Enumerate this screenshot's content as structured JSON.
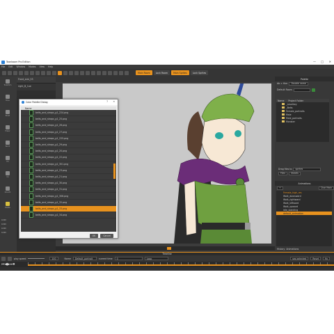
{
  "app": {
    "title": "Toonboom Pro Edition",
    "window_controls": [
      "—",
      "□",
      "✕"
    ]
  },
  "menu": [
    "File",
    "Edit",
    "Window",
    "Modes",
    "View",
    "Help"
  ],
  "rooms": [
    {
      "label": "Main Room",
      "active": true
    },
    {
      "label": "Lock Room",
      "active": false
    },
    {
      "label": "Main Sprites",
      "active": true
    },
    {
      "label": "Lock Sprites",
      "active": false
    }
  ],
  "left_tools": [
    "Transform",
    "Bone",
    "Brush",
    "Eraser",
    "Pencil",
    "Fill",
    "Ink",
    "Smooth",
    "Palette"
  ],
  "tool_props": [
    "0.000",
    "0.000",
    "0.000",
    "0.000"
  ],
  "level_strip": {
    "name": "Front_arm_55",
    "sub": "right_B_1ue"
  },
  "dialog": {
    "title": "Color Palette Dialog",
    "help": "?",
    "close": "✕",
    "column_header": "Name",
    "files": [
      "belts_and_straps_g1_224.png",
      "belts_and_straps_g1_25.png",
      "belts_and_straps_g1_26.png",
      "belts_and_straps_g1_27.png",
      "belts_and_straps_g1_225.png",
      "belts_and_straps_g1_29.png",
      "belts_and_straps_g1_20.png",
      "belts_and_straps_g1_22.png",
      "belts_and_straps_g1_301.png",
      "belts_and_straps_g1_23.png",
      "belts_and_straps_g1_21.png",
      "belts_and_straps_g1_30.png",
      "belts_and_straps_g1_31.png",
      "belts_and_straps_g1_306.png",
      "belts_and_straps_g1_32.png",
      "belts_and_straps_g1_33.png",
      "belts_and_straps_g1_34.png"
    ],
    "selected_index": 15,
    "ok": "OK",
    "cancel": "Cancel"
  },
  "palette_panel": {
    "title": "Palette",
    "mode_label": "Ab > Hier",
    "mode_value": "Double name",
    "default_label": "Default Room",
    "tree_headers": [
      "Name",
      "Project Folder"
    ],
    "tree": [
      "_Levelkey",
      "_Belts",
      "Female_portraits",
      "Male",
      "Male_portraits",
      "Monster"
    ],
    "bottom_field_label": "Drag files to",
    "bottom_field_value": "sprites",
    "bottom_tabs": [
      "Files",
      "Sheets"
    ]
  },
  "animations_panel": {
    "title": "Animations",
    "new_anim": "+",
    "char_label": "Char Main",
    "items": [
      "Female_high_res",
      "Walk_downward",
      "Walk_rightward",
      "Walk_leftward",
      "Walk_upward",
      "Idle_standing",
      "default_animation"
    ],
    "selected_index": 6,
    "tabs": [
      "History",
      "Animations"
    ]
  },
  "timeline": {
    "title": "Timeline",
    "fps_label": "play speed",
    "fps_value": "100",
    "name_label": "Name",
    "name_value": "Default_portrait",
    "current_label": "current time",
    "current_value": "0",
    "loop_label": "Loop",
    "seek_label": "seq selected",
    "reset_label": "Reset",
    "fix_label": "fix"
  },
  "colors": {
    "accent": "#e8921e",
    "panel": "#383838",
    "canvas": "#c9c9c9"
  }
}
